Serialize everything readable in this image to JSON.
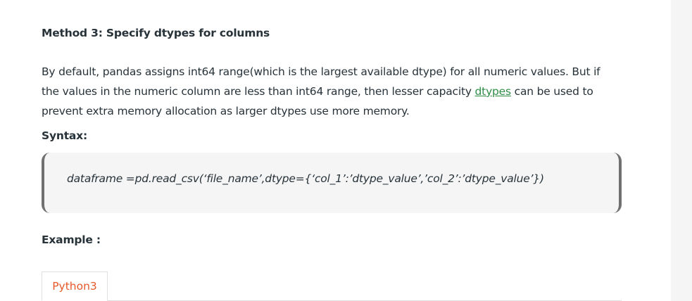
{
  "article": {
    "heading": "Method 3: Specify dtypes for columns",
    "paragraph_before_link": "By default, pandas assigns int64 range(which is the largest available dtype) for all numeric values. But if the values in the numeric column are less than int64 range, then lesser capacity ",
    "paragraph_link": "dtypes",
    "paragraph_after_link": " can be used to prevent extra memory allocation as larger dtypes use more memory.",
    "syntax_label": "Syntax:",
    "syntax_code": "dataframe =pd.read_csv(‘file_name’,dtype={‘col_1’:’dtype_value’,’col_2’:’dtype_value’})",
    "example_label": "Example :",
    "tabs": [
      {
        "label": "Python3"
      }
    ]
  },
  "colors": {
    "link": "#2f8d46",
    "active_tab_text": "#e8582a",
    "code_border": "#707070",
    "code_background": "#f5f5f5",
    "text": "#273239"
  }
}
